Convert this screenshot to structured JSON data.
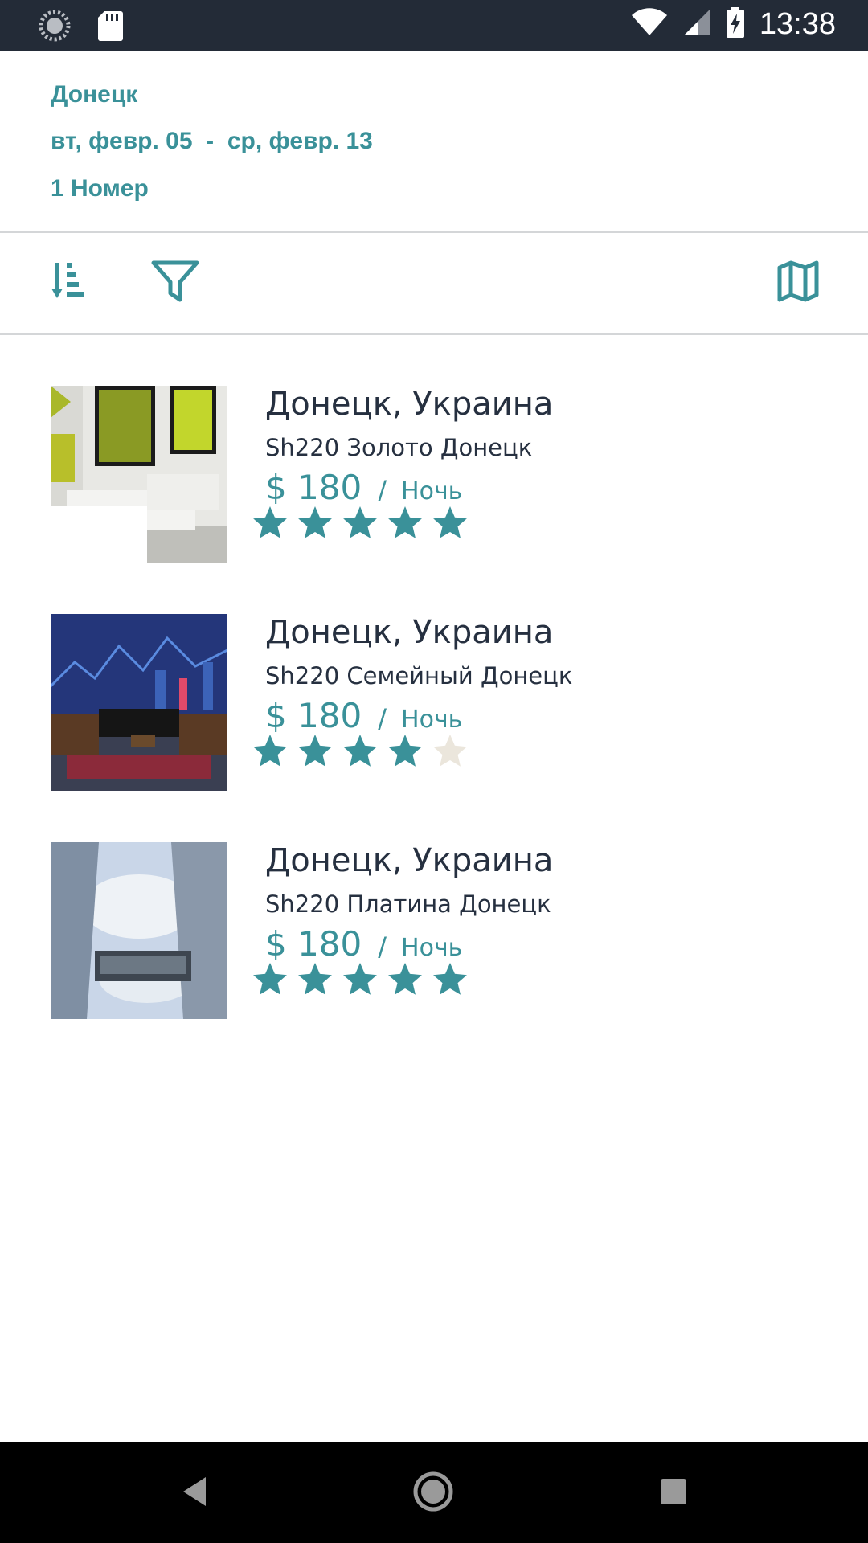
{
  "status_bar": {
    "time": "13:38",
    "icons": [
      "sync-icon",
      "sd-card-icon",
      "wifi-icon",
      "signal-icon",
      "battery-charging-icon"
    ]
  },
  "search_summary": {
    "city": "Донецк",
    "dates": "вт, февр. 05  -  ср, февр. 13",
    "rooms": "1 Номер"
  },
  "toolbar": {
    "icons": [
      "sort-icon",
      "filter-icon",
      "map-icon"
    ]
  },
  "results": [
    {
      "location": "Донецк, Украина",
      "name": "Sh220 Золото Донецк",
      "price": "$ 180",
      "separator": "/",
      "per": "Ночь",
      "rating": 5
    },
    {
      "location": "Донецк, Украина",
      "name": "Sh220 Семейный Донецк",
      "price": "$ 180",
      "separator": "/",
      "per": "Ночь",
      "rating": 4
    },
    {
      "location": "Донецк, Украина",
      "name": "Sh220 Платина Донецк",
      "price": "$ 180",
      "separator": "/",
      "per": "Ночь",
      "rating": 5
    }
  ],
  "colors": {
    "accent": "#3a9199",
    "star_filled": "#3a9199",
    "star_empty": "#ebe6dc",
    "status_bar": "#232b37",
    "nav_bar": "#000000",
    "text_dark": "#263040"
  },
  "nav_bar": {
    "icons": [
      "back-icon",
      "home-icon",
      "recents-icon"
    ]
  }
}
